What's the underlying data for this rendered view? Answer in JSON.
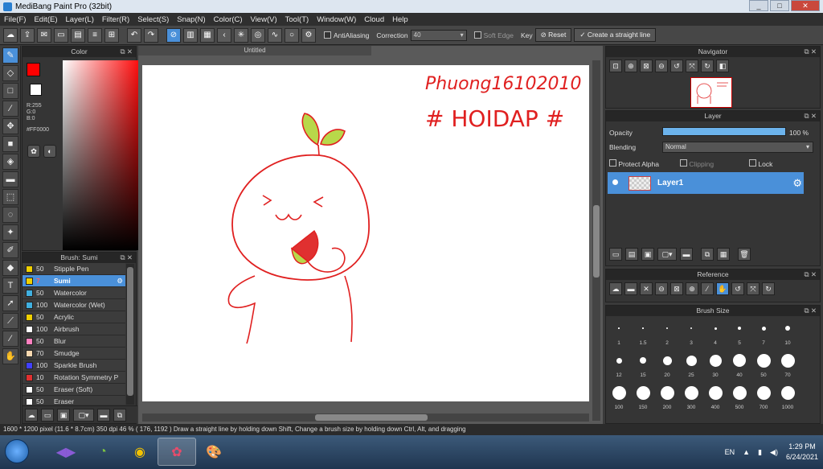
{
  "window": {
    "title": "MediBang Paint Pro (32bit)",
    "min": "_",
    "max": "□",
    "close": "✕"
  },
  "menu": [
    "File(F)",
    "Edit(E)",
    "Layer(L)",
    "Filter(R)",
    "Select(S)",
    "Snap(N)",
    "Color(C)",
    "View(V)",
    "Tool(T)",
    "Window(W)",
    "Cloud",
    "Help"
  ],
  "toolbar": {
    "antialiasing_label": "AntiAliasing",
    "correction_label": "Correction",
    "correction_value": "40",
    "soft_edge_label": "Soft Edge",
    "key_label": "Key",
    "reset_label": "Reset",
    "straight_line_label": "Create a straight line"
  },
  "color_panel": {
    "title": "Color",
    "r": "R:255",
    "g": "G:0",
    "b": "B:0",
    "hex": "#FF0000",
    "foreground": "#ff0000",
    "background": "#ffffff"
  },
  "brush_panel": {
    "title": "Brush: Sumi",
    "items": [
      {
        "size": "50",
        "name": "Stipple Pen",
        "color": "#f0d000"
      },
      {
        "size": "7",
        "name": "Sumi",
        "color": "#f0d000",
        "selected": true
      },
      {
        "size": "50",
        "name": "Watercolor",
        "color": "#40b0e0"
      },
      {
        "size": "100",
        "name": "Watercolor (Wet)",
        "color": "#40b0e0"
      },
      {
        "size": "50",
        "name": "Acrylic",
        "color": "#f0d000"
      },
      {
        "size": "100",
        "name": "Airbrush",
        "color": "#ffffff"
      },
      {
        "size": "50",
        "name": "Blur",
        "color": "#ff80c0"
      },
      {
        "size": "70",
        "name": "Smudge",
        "color": "#f8d8b0"
      },
      {
        "size": "100",
        "name": "Sparkle Brush",
        "color": "#4040ff"
      },
      {
        "size": "10",
        "name": "Rotation Symmetry P",
        "color": "#e03030"
      },
      {
        "size": "50",
        "name": "Eraser (Soft)",
        "color": "#ffffff"
      },
      {
        "size": "50",
        "name": "Eraser",
        "color": "#ffffff"
      }
    ]
  },
  "document": {
    "tab": "Untitled",
    "handwriting_line1": "Phuong16102010",
    "handwriting_line2": "# HOIDAP #"
  },
  "navigator": {
    "title": "Navigator"
  },
  "layer_panel": {
    "title": "Layer",
    "opacity_label": "Opacity",
    "opacity_value": "100 %",
    "opacity_level": 1.0,
    "blending_label": "Blending",
    "blending_value": "Normal",
    "protect_alpha_label": "Protect Alpha",
    "clipping_label": "Clipping",
    "lock_label": "Lock",
    "layer_name": "Layer1"
  },
  "reference_panel": {
    "title": "Reference"
  },
  "brush_size_panel": {
    "title": "Brush Size",
    "sizes": [
      "1",
      "1.5",
      "2",
      "3",
      "4",
      "5",
      "7",
      "10",
      "12",
      "15",
      "20",
      "25",
      "30",
      "40",
      "50",
      "70",
      "100",
      "150",
      "200",
      "300",
      "400",
      "500",
      "700",
      "1000"
    ]
  },
  "status": {
    "text": "1600 * 1200 pixel  (11.6 * 8.7cm)  350 dpi  46 %  ( 176, 1192 )  Draw a straight line by holding down Shift, Change a brush size by holding down Ctrl, Alt, and dragging"
  },
  "taskbar": {
    "lang": "EN",
    "time": "1:29 PM",
    "date": "6/24/2021"
  }
}
